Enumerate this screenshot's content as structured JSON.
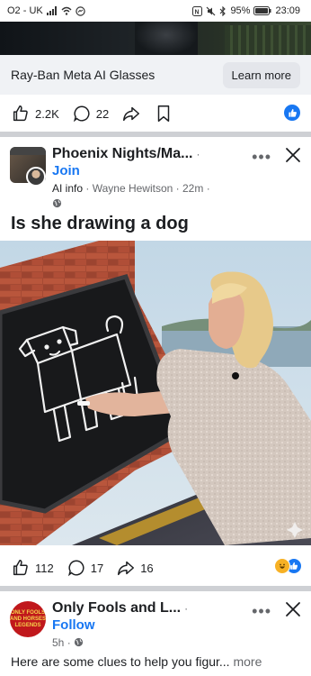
{
  "status_bar": {
    "carrier": "O2 - UK",
    "battery": "95%",
    "time": "23:09"
  },
  "ad": {
    "title": "Ray-Ban Meta AI Glasses",
    "cta": "Learn more",
    "likes": "2.2K",
    "comments": "22"
  },
  "post1": {
    "group_name": "Phoenix Nights/Ma...",
    "group_suffix": "·",
    "join_label": "Join",
    "ai_info": "AI info",
    "author": "Wayne Hewitson",
    "time": "22m",
    "text": "Is she drawing a dog",
    "likes": "112",
    "comments": "17",
    "shares": "16"
  },
  "post2": {
    "group_name": "Only Fools and L...",
    "group_suffix": "·",
    "follow_label": "Follow",
    "time": "5h",
    "avatar_text": "ONLY FOOLS AND HORSES LEGENDS",
    "text": "Here are some clues to help you figur...",
    "more_label": "more"
  },
  "colors": {
    "brand_blue": "#1877f2",
    "text": "#1c1e21",
    "muted": "#65676b"
  }
}
